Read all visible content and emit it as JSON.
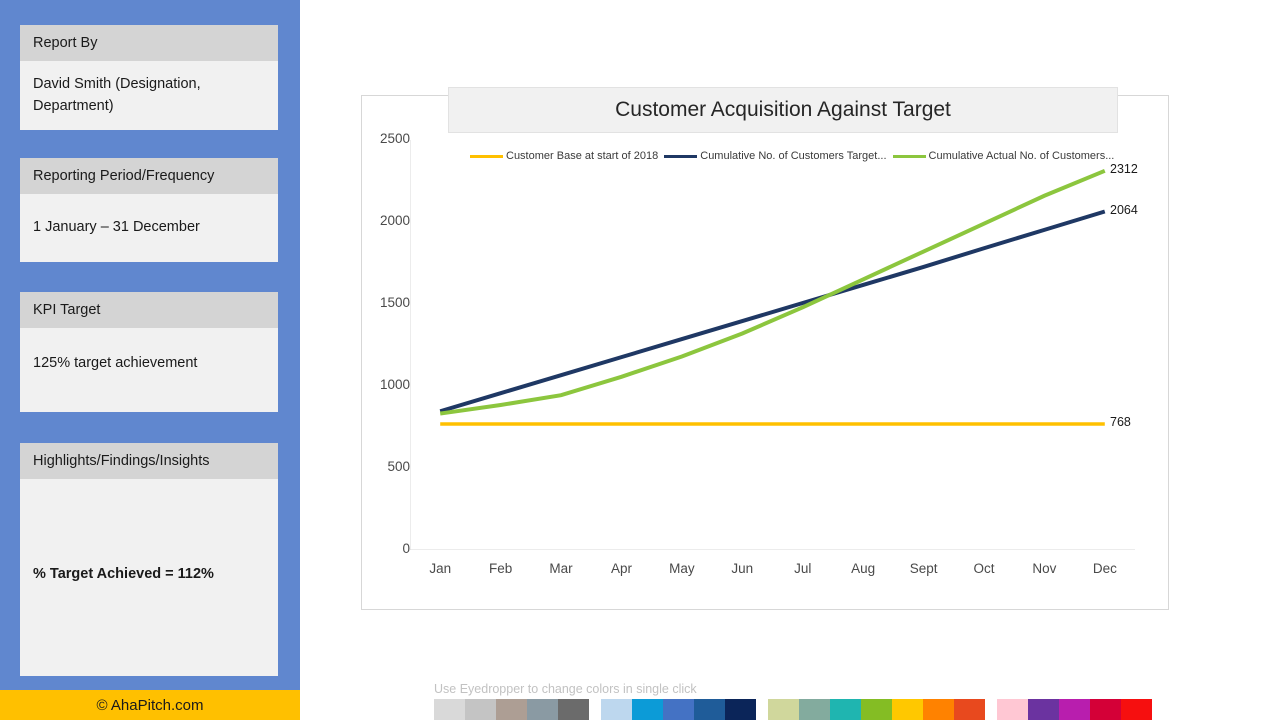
{
  "sidebar": {
    "background_color": "#6087cf",
    "cards": [
      {
        "name": "report-by",
        "header": "Report By",
        "body": "David Smith (Designation, Department)"
      },
      {
        "name": "reporting-period",
        "header": "Reporting Period/Frequency",
        "body": "1 January – 31 December"
      },
      {
        "name": "kpi-target",
        "header": "KPI Target",
        "body": "125% target achievement"
      },
      {
        "name": "highlights",
        "header": "Highlights/Findings/Insights",
        "body": "% Target Achieved = 112%"
      }
    ]
  },
  "footer": {
    "text": "© AhaPitch.com",
    "background_color": "#ffc000"
  },
  "chart_data": {
    "type": "line",
    "title": "Customer Acquisition Against Target",
    "xlabel": "",
    "ylabel": "",
    "ylim": [
      0,
      2500
    ],
    "yticks": [
      2500,
      2000,
      1500,
      1000,
      500,
      0
    ],
    "grid": false,
    "legend_position": "top-left",
    "categories": [
      "Jan",
      "Feb",
      "Mar",
      "Apr",
      "May",
      "Jun",
      "Jul",
      "Aug",
      "Sept",
      "Oct",
      "Nov",
      "Dec"
    ],
    "series": [
      {
        "name": "Customer Base at start of 2018",
        "legend_label": "Customer Base at start of 2018",
        "color": "#ffc000",
        "end_label": "768",
        "values": [
          768,
          768,
          768,
          768,
          768,
          768,
          768,
          768,
          768,
          768,
          768,
          768
        ]
      },
      {
        "name": "Cumulative No. of Customers Target",
        "legend_label": "Cumulative No. of Customers Target...",
        "color": "#1f3864",
        "end_label": "2064",
        "values": [
          846,
          956,
          1066,
          1176,
          1286,
          1396,
          1506,
          1616,
          1726,
          1840,
          1952,
          2064
        ]
      },
      {
        "name": "Cumulative Actual No. of Customers",
        "legend_label": "Cumulative Actual No. of Customers...",
        "color": "#8cc63e",
        "end_label": "2312",
        "values": [
          832,
          884,
          944,
          1056,
          1180,
          1320,
          1480,
          1650,
          1820,
          1990,
          2160,
          2312
        ]
      }
    ]
  },
  "eyedropper": {
    "hint": "Use Eyedropper to change colors in single click",
    "groups": [
      [
        "#d9d9d9",
        "#c4c4c4",
        "#ad9e94",
        "#8a9aa3",
        "#6b6b6b"
      ],
      [
        "#bdd7ee",
        "#0c9bd7",
        "#4472c4",
        "#1f5c99",
        "#0b2559"
      ],
      [
        "#d0d79c",
        "#83ab9e",
        "#1fb5b0",
        "#84bd24",
        "#ffc800",
        "#ff8200",
        "#e8491e"
      ],
      [
        "#ffc7d3",
        "#6b33a0",
        "#b81eae",
        "#d40037",
        "#f60f0f"
      ]
    ]
  }
}
